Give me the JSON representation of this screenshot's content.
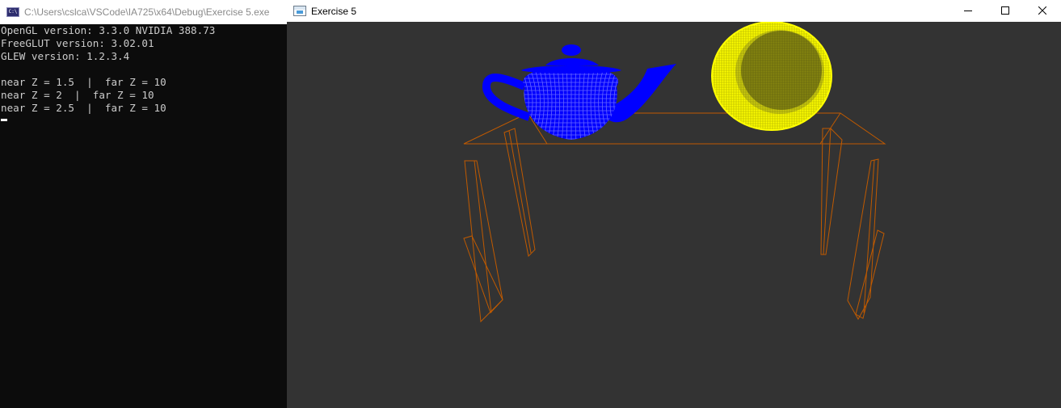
{
  "console": {
    "title": "C:\\Users\\cslca\\VSCode\\IA725\\x64\\Debug\\Exercise 5.exe",
    "icon": "console-app-icon",
    "icon_text": "C:\\",
    "lines": [
      "OpenGL version: 3.3.0 NVIDIA 388.73",
      "FreeGLUT version: 3.02.01",
      "GLEW version: 1.2.3.4",
      "",
      "near Z = 1.5  |  far Z = 10",
      "near Z = 2  |  far Z = 10",
      "near Z = 2.5  |  far Z = 10"
    ]
  },
  "gl_window": {
    "title": "Exercise 5",
    "icon": "window-app-icon",
    "controls": {
      "minimize_icon": "minimize-icon",
      "maximize_icon": "maximize-icon",
      "close_icon": "close-icon"
    }
  },
  "scene": {
    "background_color": "#333333",
    "objects": [
      {
        "name": "teapot",
        "render": "wireframe",
        "color": "#0000ff"
      },
      {
        "name": "sphere",
        "render": "wireframe",
        "color": "#ffff00"
      },
      {
        "name": "table",
        "render": "wireframe",
        "color": "#c05a00"
      }
    ]
  }
}
